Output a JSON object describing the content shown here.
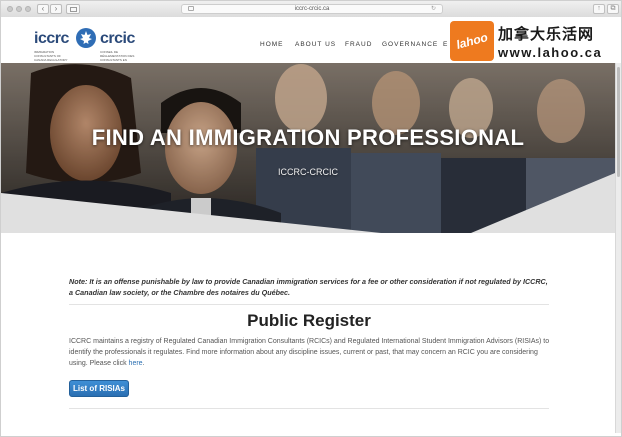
{
  "browser": {
    "url": "iccrc-crcic.ca",
    "back_glyph": "‹",
    "forward_glyph": "›",
    "reload_glyph": "↻",
    "share_glyph": "↑",
    "tabs_glyph": "⧉"
  },
  "header": {
    "logo_en": "iccrc",
    "logo_fr": "crcic",
    "logo_sub_en": "IMMIGRATION CONSULTANTS OF CANADA REGULATORY COUNCIL",
    "logo_sub_fr": "CONSEIL DE RÉGLEMENTATION DES CONSULTANTS EN IMMIGRATION DU CANADA",
    "nav": [
      "HOME",
      "ABOUT US",
      "FRAUD",
      "GOVERNANCE",
      "E"
    ]
  },
  "watermark": {
    "badge": "lahoo",
    "chinese": "加拿大乐活网",
    "url": "www.lahoo.ca",
    "color": "#ee7a1f"
  },
  "hero": {
    "title": "FIND AN IMMIGRATION PROFESSIONAL",
    "subtitle": "ICCRC-CRCIC"
  },
  "content": {
    "note": "Note: It is an offense punishable by law to provide Canadian immigration services for a fee or other consideration if not regulated by ICCRC, a Canadian law society, or the Chambre des notaires du Québec.",
    "section_title": "Public Register",
    "description": "ICCRC maintains a registry of Regulated Canadian Immigration Consultants (RCICs) and Regulated International Student Immigration Advisors (RISIAs) to identify the professionals it regulates. Find more information about any discipline issues, current or past, that may concern an RCIC you are considering using. Please click",
    "link_text": "here",
    "description_end": ".",
    "button_label": "List of RISIAs"
  },
  "colors": {
    "brand": "#2b4a7a",
    "link": "#2a6fb2",
    "button": "#2a6fb2"
  }
}
